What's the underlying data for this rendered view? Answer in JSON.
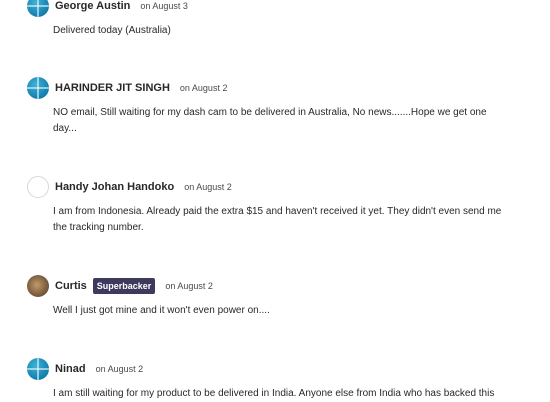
{
  "comments": [
    {
      "author": "George Austin",
      "badge": "",
      "date": "on August 3",
      "avatar": "globe-avatar-icon",
      "text": "Delivered today (Australia)"
    },
    {
      "author": "HARINDER JIT SINGH",
      "badge": "",
      "date": "on August 2",
      "avatar": "globe-avatar-icon",
      "text": "NO email, Still waiting for my dash cam to be delivered in Australia, No news.......Hope we get one day..."
    },
    {
      "author": "Handy Johan Handoko",
      "badge": "",
      "date": "on August 2",
      "avatar": "default-avatar-icon",
      "text": "I am from Indonesia. Already paid the extra $15 and haven't received it yet. They didn't even send me the tracking number."
    },
    {
      "author": "Curtis",
      "badge": "Superbacker",
      "date": "on August 2",
      "avatar": "photo-avatar",
      "text": "Well I just got mine and it won't even power on...."
    },
    {
      "author": "Ninad",
      "badge": "",
      "date": "on August 2",
      "avatar": "globe-avatar-icon",
      "text": "I am still waiting for my product to be delivered in India. Anyone else from India who has backed this"
    }
  ],
  "colors": {
    "avatar_teal": "#1786b4",
    "badge_bg": "#3e3a5e",
    "text": "#282828"
  }
}
